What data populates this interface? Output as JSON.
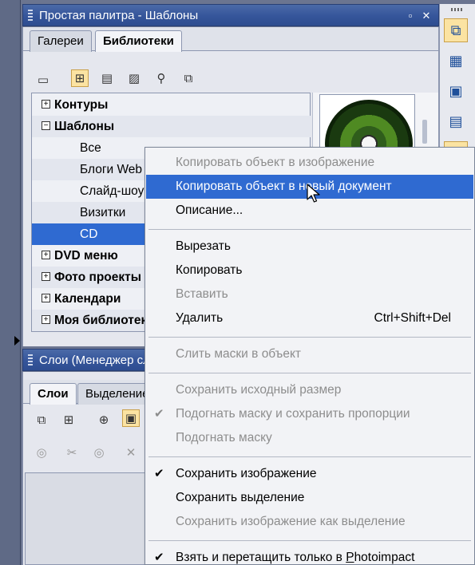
{
  "palette_panel": {
    "title": "Простая палитра - Шаблоны",
    "tabs": [
      "Галереи",
      "Библиотеки"
    ],
    "active_tab": "Библиотеки",
    "tree": [
      {
        "label": "Контуры",
        "bold": true,
        "expander": "+"
      },
      {
        "label": "Шаблоны",
        "bold": true,
        "expander": "−"
      },
      {
        "label": "Все",
        "bold": false
      },
      {
        "label": "Блоги Web",
        "bold": false
      },
      {
        "label": "Слайд-шоу",
        "bold": false
      },
      {
        "label": "Визитки",
        "bold": false
      },
      {
        "label": "CD",
        "bold": false,
        "selected": true
      },
      {
        "label": "DVD меню",
        "bold": true,
        "expander": "+"
      },
      {
        "label": "Фото проекты",
        "bold": true,
        "expander": "+"
      },
      {
        "label": "Календари",
        "bold": true,
        "expander": "+"
      },
      {
        "label": "Моя библиотека",
        "bold": true,
        "expander": "+"
      }
    ]
  },
  "layers_panel": {
    "title": "Слои (Менеджер слоёв)",
    "tabs": [
      "Слои",
      "Выделение"
    ],
    "active_tab": "Слои"
  },
  "context_menu": {
    "items": [
      {
        "label": "Копировать объект в изображение",
        "disabled": true
      },
      {
        "label": "Копировать объект в новый документ",
        "highlighted": true
      },
      {
        "label": "Описание...",
        "disabled": false
      },
      {
        "label": "Вырезать",
        "disabled": false
      },
      {
        "label": "Копировать",
        "disabled": false
      },
      {
        "label": "Вставить",
        "disabled": true
      },
      {
        "label": "Удалить",
        "shortcut": "Ctrl+Shift+Del",
        "disabled": false
      },
      {
        "label": "Слить маски в объект",
        "disabled": true
      },
      {
        "label": "Сохранить исходный размер",
        "disabled": true
      },
      {
        "label": "Подогнать маску и сохранить пропорции",
        "disabled": true,
        "checked": true
      },
      {
        "label": "Подогнать маску",
        "disabled": true
      },
      {
        "label": "Сохранить изображение",
        "checked": true
      },
      {
        "label": "Сохранить выделение"
      },
      {
        "label": "Сохранить изображение как выделение",
        "disabled": true
      },
      {
        "label_prefix": "Взять и перетащить только в ",
        "label_underlined": "P",
        "label_suffix": "hotoimpact",
        "checked": true
      }
    ]
  },
  "colors": {
    "title_bar": "#35559a",
    "selection": "#2f6ad1",
    "toggle_on": "#fbe3a2"
  }
}
